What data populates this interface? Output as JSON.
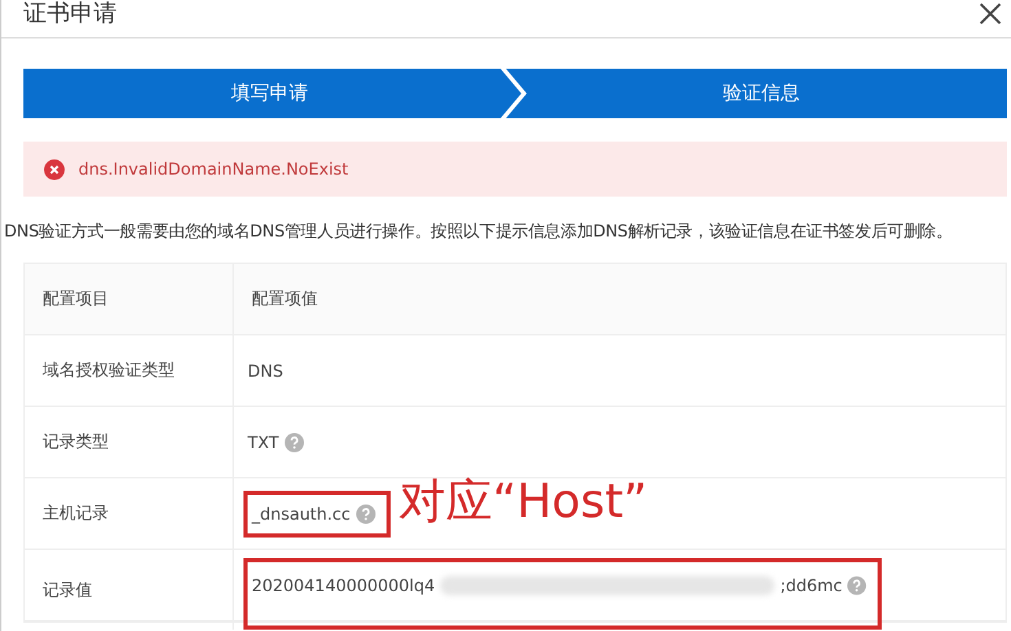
{
  "dialog": {
    "title": "证书申请"
  },
  "steps": [
    {
      "label": "填写申请",
      "done": true
    },
    {
      "label": "验证信息",
      "done": true
    }
  ],
  "error": {
    "message": "dns.InvalidDomainName.NoExist"
  },
  "description": "DNS验证方式一般需要由您的域名DNS管理人员进行操作。按照以下提示信息添加DNS解析记录，该验证信息在证书签发后可删除。",
  "table": {
    "columns": [
      "配置项目",
      "配置项值"
    ],
    "rows": [
      {
        "name": "域名授权验证类型",
        "value": "DNS",
        "help": false,
        "highlighted": false
      },
      {
        "name": "记录类型",
        "value": "TXT",
        "help": true,
        "highlighted": false
      },
      {
        "name": "主机记录",
        "value": "_dnsauth.cc",
        "help": true,
        "highlighted": true
      },
      {
        "name": "记录值",
        "value": "202004140000000lq4",
        "value_end": ";dd6mc",
        "redacted": true,
        "help": true,
        "highlighted": true
      }
    ]
  },
  "annotation": {
    "text": "对应“Host”"
  }
}
